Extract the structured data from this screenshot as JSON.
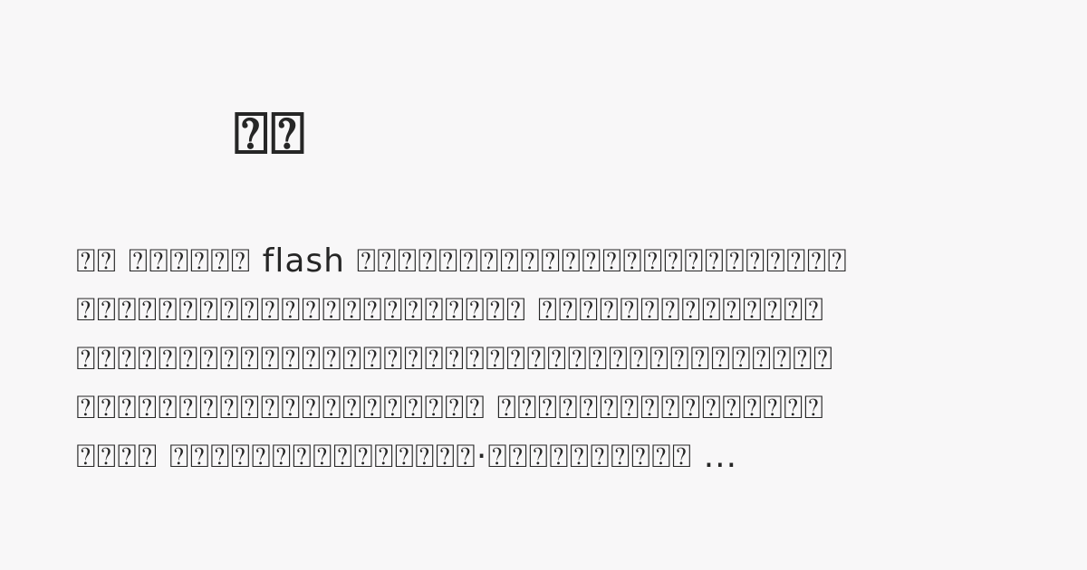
{
  "card": {
    "title": "⍰⍰",
    "excerpt_lines": [
      "⍰⍰ ⍰⍰⍰⍰⍰⍰ flash ⍰⍰⍰⍰⍰⍰⍰⍰⍰⍰⍰⍰⍰⍰⍰⍰⍰⍰⍰⍰⍰⍰⍰⍰",
      "⍰⍰⍰⍰⍰⍰⍰⍰⍰⍰⍰⍰⍰⍰⍰⍰⍰⍰⍰⍰⍰⍰ ⍰⍰⍰⍰⍰⍰⍰⍰⍰⍰⍰⍰⍰⍰",
      "⍰⍰⍰⍰⍰⍰⍰⍰⍰⍰⍰⍰⍰⍰⍰⍰⍰⍰⍰⍰⍰⍰⍰⍰⍰⍰⍰⍰⍰⍰⍰⍰⍰⍰⍰⍰⍰",
      "⍰⍰⍰⍰⍰⍰⍰⍰⍰⍰⍰⍰⍰⍰⍰⍰⍰⍰⍰⍰ ⍰⍰⍰⍰⍰⍰⍰⍰⍰⍰⍰⍰⍰⍰⍰⍰",
      "⍰⍰⍰⍰ ⍰⍰⍰⍰⍰⍰⍰⍰⍰⍰⍰⍰⍰⍰⍰·⍰⍰⍰⍰⍰⍰⍰⍰⍰⍰ ..."
    ]
  }
}
